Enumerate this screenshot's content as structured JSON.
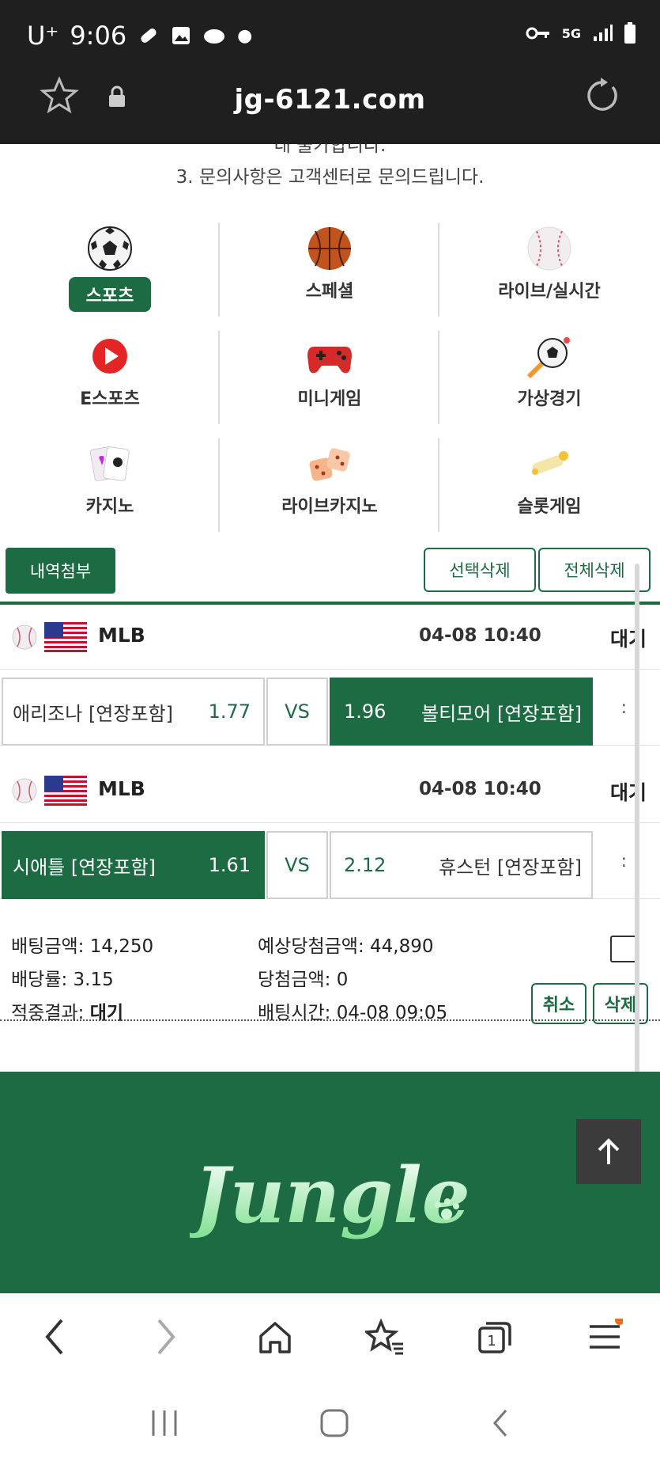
{
  "status_bar": {
    "carrier": "U⁺",
    "time": "9:06",
    "network": "5G"
  },
  "browser": {
    "url": "jg-6121.com"
  },
  "notice": {
    "line1": "대 불가합니다.",
    "line2": "3. 문의사항은 고객센터로 문의드립니다."
  },
  "categories": [
    {
      "label": "스포츠",
      "icon": "soccer-ball-icon",
      "active": true
    },
    {
      "label": "스페셜",
      "icon": "basketball-icon"
    },
    {
      "label": "라이브/실시간",
      "icon": "baseball-icon"
    },
    {
      "label": "E스포츠",
      "icon": "play-button-icon"
    },
    {
      "label": "미니게임",
      "icon": "gamepad-icon"
    },
    {
      "label": "가상경기",
      "icon": "rocket-ball-icon"
    },
    {
      "label": "카지노",
      "icon": "cards-icon"
    },
    {
      "label": "라이브카지노",
      "icon": "dice-icon"
    },
    {
      "label": "슬롯게임",
      "icon": "slot-icon"
    }
  ],
  "toolbar": {
    "attach_label": "내역첨부",
    "select_delete_label": "선택삭제",
    "delete_all_label": "전체삭제"
  },
  "bets": [
    {
      "league": "MLB",
      "datetime": "04-08 10:40",
      "status": "대기",
      "home": {
        "team": "애리조나 [연장포함]",
        "odds": "1.77",
        "selected": false
      },
      "vs": "VS",
      "away": {
        "team": "볼티모어 [연장포함]",
        "odds": "1.96",
        "selected": true
      },
      "extra": ":"
    },
    {
      "league": "MLB",
      "datetime": "04-08 10:40",
      "status": "대기",
      "home": {
        "team": "시애틀 [연장포함]",
        "odds": "1.61",
        "selected": true
      },
      "vs": "VS",
      "away": {
        "team": "휴스턴 [연장포함]",
        "odds": "2.12",
        "selected": false
      },
      "extra": ":"
    }
  ],
  "summary": {
    "bet_amount_label": "배팅금액:",
    "bet_amount": "14,250",
    "odds_label": "배당률:",
    "odds": "3.15",
    "result_label": "적중결과:",
    "result": "대기",
    "expected_label": "예상당첨금액:",
    "expected": "44,890",
    "win_label": "당첨금액:",
    "win": "0",
    "time_label": "배팅시간:",
    "time": "04-08 09:05",
    "cancel_label": "취소",
    "delete_label": "삭제"
  },
  "footer": {
    "logo_text": "Jungle"
  },
  "colors": {
    "brand_green": "#1c6b43",
    "dark_bar": "#1f1f1f"
  }
}
